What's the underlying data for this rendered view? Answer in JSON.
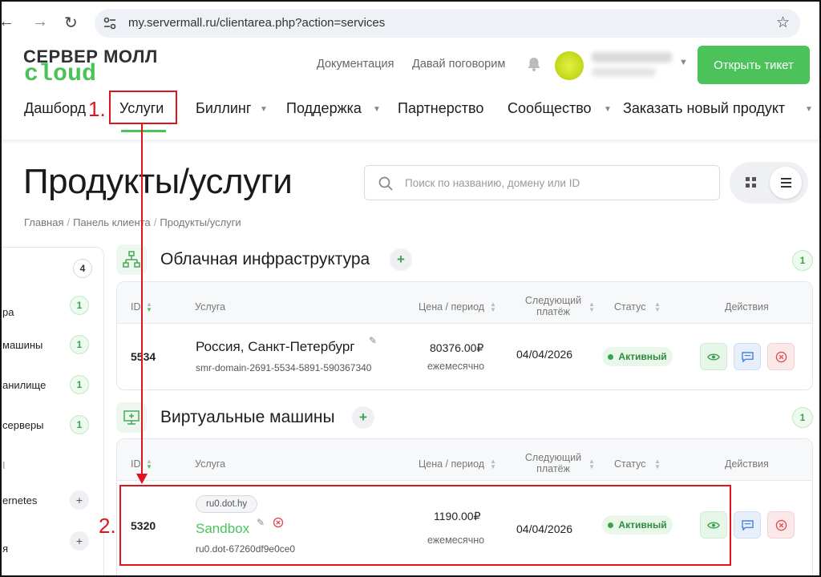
{
  "browser": {
    "url": "my.servermall.ru/clientarea.php?action=services"
  },
  "logo": {
    "top": "СЕРВЕР МОЛЛ",
    "bottom": "cloud"
  },
  "header": {
    "links": [
      "Документация",
      "Давай поговорим"
    ],
    "ticket_button": "Открыть тикет"
  },
  "menu": {
    "items": [
      "Дашборд",
      "Услуги",
      "Биллинг",
      "Поддержка",
      "Партнерство",
      "Сообщество",
      "Заказать новый продукт"
    ]
  },
  "page": {
    "title": "Продукты/услуги",
    "search_placeholder": "Поиск по названию, домену или ID",
    "breadcrumb": [
      "Главная",
      "Панель клиента",
      "Продукты/услуги"
    ]
  },
  "sidebar": {
    "total": "4",
    "items": [
      {
        "label": "ра",
        "count": "1"
      },
      {
        "label": "машины",
        "count": "1"
      },
      {
        "label": "анилище",
        "count": "1"
      },
      {
        "label": "серверы",
        "count": "1"
      },
      {
        "label": "I",
        "count": ""
      },
      {
        "label": "ernetes",
        "count": "+"
      },
      {
        "label": "я",
        "count": "+"
      }
    ]
  },
  "sections": [
    {
      "title": "Облачная инфраструктура",
      "count": "1",
      "headers": {
        "id": "ID",
        "service": "Услуга",
        "price": "Цена / период",
        "next": "Следующий платёж",
        "status": "Статус",
        "actions": "Действия"
      },
      "row": {
        "id": "5534",
        "name": "Россия, Санкт-Петербург",
        "sub": "smr-domain-2691-5534-5891-590367340",
        "price": "80376.00₽",
        "period": "ежемесячно",
        "date": "04/04/2026",
        "status": "Активный"
      }
    },
    {
      "title": "Виртуальные машины",
      "count": "1",
      "headers": {
        "id": "ID",
        "service": "Услуга",
        "price": "Цена / период",
        "next": "Следующий платёж",
        "status": "Статус",
        "actions": "Действия"
      },
      "row": {
        "id": "5320",
        "tag": "ru0.dot.hy",
        "name": "Sandbox",
        "sub": "ru0.dot-67260df9e0ce0",
        "price": "1190.00₽",
        "period": "ежемесячно",
        "date": "04/04/2026",
        "status": "Активный"
      }
    }
  ],
  "annotations": {
    "step1": "1.",
    "step2": "2."
  },
  "colors": {
    "brand_green": "#4bc35a",
    "annotation_red": "#e0141e"
  }
}
